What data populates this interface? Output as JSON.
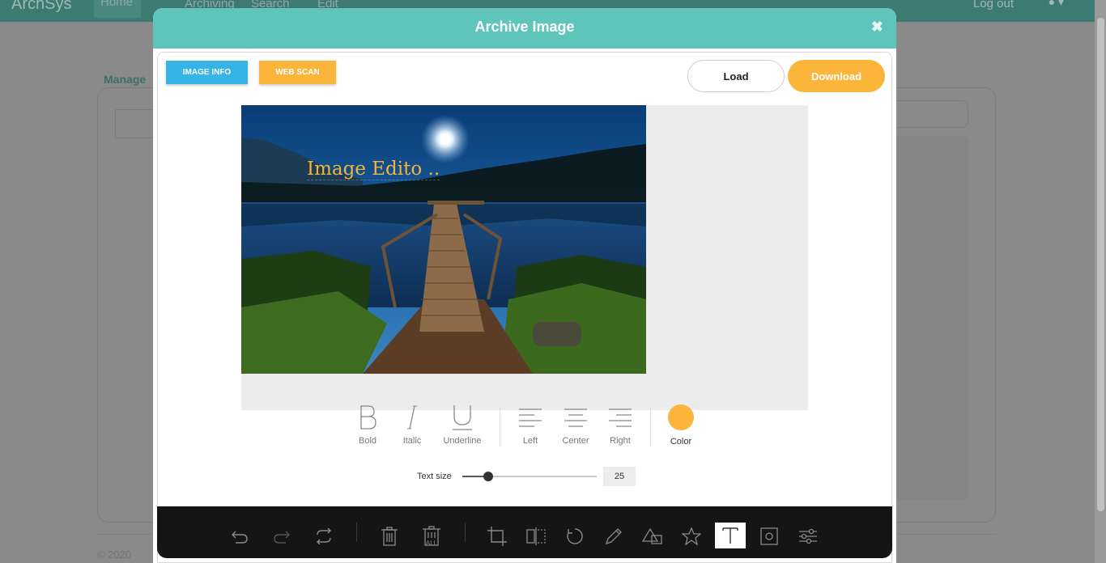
{
  "app": {
    "brand": "ArchSys",
    "nav": [
      "Home",
      "Archiving",
      "Search",
      "Edit"
    ],
    "logout": "Log out",
    "page_heading": "Manage",
    "footer": "© 2020"
  },
  "modal": {
    "title": "Archive Image",
    "close_icon": "close-icon",
    "buttons": {
      "image_info": "IMAGE INFO",
      "web_scan": "WEB SCAN",
      "load": "Load",
      "download": "Download"
    }
  },
  "canvas": {
    "image": "lake dock at night under moon",
    "text_object": "Image Edito .."
  },
  "text_tools": {
    "bold": "Bold",
    "italic": "Italic",
    "underline": "Underline",
    "left": "Left",
    "center": "Center",
    "right": "Right",
    "color": "Color",
    "color_value": "#fbb53a"
  },
  "text_size": {
    "label": "Text size",
    "value": "25",
    "slider_fraction": 0.19
  },
  "toolbar": {
    "items": [
      "undo-icon",
      "redo-icon",
      "reset-icon",
      "delete-icon",
      "delete-all-icon",
      "crop-icon",
      "flip-icon",
      "rotate-icon",
      "draw-icon",
      "shape-icon",
      "icon-icon",
      "text-icon",
      "mask-icon",
      "filter-icon"
    ],
    "active": "text-icon",
    "delete_all_label": "ALL"
  },
  "colors": {
    "header": "#5fc4b9",
    "image_info_button": "#34b5e5",
    "accent": "#fbb53a",
    "toolbar": "#151515"
  }
}
